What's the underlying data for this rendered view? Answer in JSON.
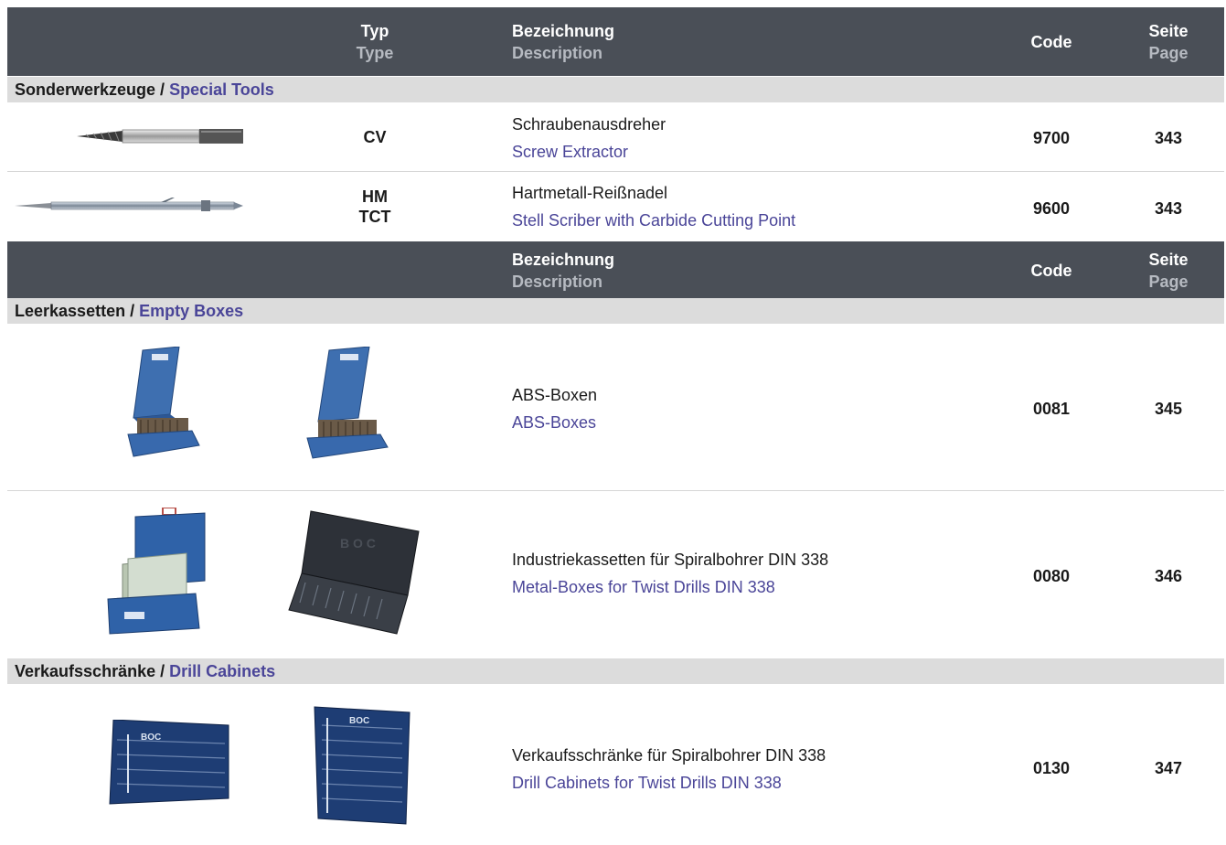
{
  "header1": {
    "type_de": "Typ",
    "type_en": "Type",
    "desc_de": "Bezeichnung",
    "desc_en": "Description",
    "code": "Code",
    "page_de": "Seite",
    "page_en": "Page"
  },
  "header2": {
    "desc_de": "Bezeichnung",
    "desc_en": "Description",
    "code": "Code",
    "page_de": "Seite",
    "page_en": "Page"
  },
  "sections": {
    "special": {
      "de": "Sonderwerkzeuge /",
      "en": "Special Tools"
    },
    "boxes": {
      "de": "Leerkassetten /",
      "en": "Empty Boxes"
    },
    "cabinets": {
      "de": "Verkaufsschränke /",
      "en": "Drill Cabinets"
    }
  },
  "rows": {
    "extractor": {
      "type": "CV",
      "de": "Schraubenausdreher",
      "en": "Screw Extractor",
      "code": "9700",
      "page": "343"
    },
    "scriber": {
      "type_line1": "HM",
      "type_line2": "TCT",
      "de": "Hartmetall-Reißnadel",
      "en": "Stell Scriber with Carbide Cutting Point",
      "code": "9600",
      "page": "343"
    },
    "abs": {
      "de": "ABS-Boxen",
      "en": "ABS-Boxes",
      "code": "0081",
      "page": "345"
    },
    "metal": {
      "de": "Industriekassetten für Spiralbohrer DIN 338",
      "en": "Metal-Boxes for Twist Drills DIN 338",
      "code": "0080",
      "page": "346"
    },
    "cabinet": {
      "de": "Verkaufsschränke für Spiralbohrer DIN 338",
      "en": "Drill Cabinets for Twist Drills DIN 338",
      "code": "0130",
      "page": "347"
    }
  },
  "colors": {
    "header_bg": "#4a4f57",
    "section_bg": "#dcdcdc",
    "english_text": "#4a4598"
  },
  "icons": [
    "screw-extractor-image",
    "scriber-image",
    "abs-box-image",
    "metal-box-image",
    "drill-cabinet-image"
  ]
}
